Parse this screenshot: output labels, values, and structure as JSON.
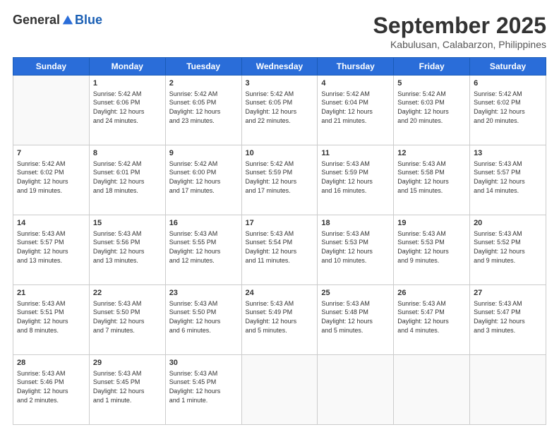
{
  "header": {
    "logo_general": "General",
    "logo_blue": "Blue",
    "month_title": "September 2025",
    "location": "Kabulusan, Calabarzon, Philippines"
  },
  "weekdays": [
    "Sunday",
    "Monday",
    "Tuesday",
    "Wednesday",
    "Thursday",
    "Friday",
    "Saturday"
  ],
  "weeks": [
    [
      {
        "day": "",
        "info": ""
      },
      {
        "day": "1",
        "info": "Sunrise: 5:42 AM\nSunset: 6:06 PM\nDaylight: 12 hours\nand 24 minutes."
      },
      {
        "day": "2",
        "info": "Sunrise: 5:42 AM\nSunset: 6:05 PM\nDaylight: 12 hours\nand 23 minutes."
      },
      {
        "day": "3",
        "info": "Sunrise: 5:42 AM\nSunset: 6:05 PM\nDaylight: 12 hours\nand 22 minutes."
      },
      {
        "day": "4",
        "info": "Sunrise: 5:42 AM\nSunset: 6:04 PM\nDaylight: 12 hours\nand 21 minutes."
      },
      {
        "day": "5",
        "info": "Sunrise: 5:42 AM\nSunset: 6:03 PM\nDaylight: 12 hours\nand 20 minutes."
      },
      {
        "day": "6",
        "info": "Sunrise: 5:42 AM\nSunset: 6:02 PM\nDaylight: 12 hours\nand 20 minutes."
      }
    ],
    [
      {
        "day": "7",
        "info": "Sunrise: 5:42 AM\nSunset: 6:02 PM\nDaylight: 12 hours\nand 19 minutes."
      },
      {
        "day": "8",
        "info": "Sunrise: 5:42 AM\nSunset: 6:01 PM\nDaylight: 12 hours\nand 18 minutes."
      },
      {
        "day": "9",
        "info": "Sunrise: 5:42 AM\nSunset: 6:00 PM\nDaylight: 12 hours\nand 17 minutes."
      },
      {
        "day": "10",
        "info": "Sunrise: 5:42 AM\nSunset: 5:59 PM\nDaylight: 12 hours\nand 17 minutes."
      },
      {
        "day": "11",
        "info": "Sunrise: 5:43 AM\nSunset: 5:59 PM\nDaylight: 12 hours\nand 16 minutes."
      },
      {
        "day": "12",
        "info": "Sunrise: 5:43 AM\nSunset: 5:58 PM\nDaylight: 12 hours\nand 15 minutes."
      },
      {
        "day": "13",
        "info": "Sunrise: 5:43 AM\nSunset: 5:57 PM\nDaylight: 12 hours\nand 14 minutes."
      }
    ],
    [
      {
        "day": "14",
        "info": "Sunrise: 5:43 AM\nSunset: 5:57 PM\nDaylight: 12 hours\nand 13 minutes."
      },
      {
        "day": "15",
        "info": "Sunrise: 5:43 AM\nSunset: 5:56 PM\nDaylight: 12 hours\nand 13 minutes."
      },
      {
        "day": "16",
        "info": "Sunrise: 5:43 AM\nSunset: 5:55 PM\nDaylight: 12 hours\nand 12 minutes."
      },
      {
        "day": "17",
        "info": "Sunrise: 5:43 AM\nSunset: 5:54 PM\nDaylight: 12 hours\nand 11 minutes."
      },
      {
        "day": "18",
        "info": "Sunrise: 5:43 AM\nSunset: 5:53 PM\nDaylight: 12 hours\nand 10 minutes."
      },
      {
        "day": "19",
        "info": "Sunrise: 5:43 AM\nSunset: 5:53 PM\nDaylight: 12 hours\nand 9 minutes."
      },
      {
        "day": "20",
        "info": "Sunrise: 5:43 AM\nSunset: 5:52 PM\nDaylight: 12 hours\nand 9 minutes."
      }
    ],
    [
      {
        "day": "21",
        "info": "Sunrise: 5:43 AM\nSunset: 5:51 PM\nDaylight: 12 hours\nand 8 minutes."
      },
      {
        "day": "22",
        "info": "Sunrise: 5:43 AM\nSunset: 5:50 PM\nDaylight: 12 hours\nand 7 minutes."
      },
      {
        "day": "23",
        "info": "Sunrise: 5:43 AM\nSunset: 5:50 PM\nDaylight: 12 hours\nand 6 minutes."
      },
      {
        "day": "24",
        "info": "Sunrise: 5:43 AM\nSunset: 5:49 PM\nDaylight: 12 hours\nand 5 minutes."
      },
      {
        "day": "25",
        "info": "Sunrise: 5:43 AM\nSunset: 5:48 PM\nDaylight: 12 hours\nand 5 minutes."
      },
      {
        "day": "26",
        "info": "Sunrise: 5:43 AM\nSunset: 5:47 PM\nDaylight: 12 hours\nand 4 minutes."
      },
      {
        "day": "27",
        "info": "Sunrise: 5:43 AM\nSunset: 5:47 PM\nDaylight: 12 hours\nand 3 minutes."
      }
    ],
    [
      {
        "day": "28",
        "info": "Sunrise: 5:43 AM\nSunset: 5:46 PM\nDaylight: 12 hours\nand 2 minutes."
      },
      {
        "day": "29",
        "info": "Sunrise: 5:43 AM\nSunset: 5:45 PM\nDaylight: 12 hours\nand 1 minute."
      },
      {
        "day": "30",
        "info": "Sunrise: 5:43 AM\nSunset: 5:45 PM\nDaylight: 12 hours\nand 1 minute."
      },
      {
        "day": "",
        "info": ""
      },
      {
        "day": "",
        "info": ""
      },
      {
        "day": "",
        "info": ""
      },
      {
        "day": "",
        "info": ""
      }
    ]
  ]
}
